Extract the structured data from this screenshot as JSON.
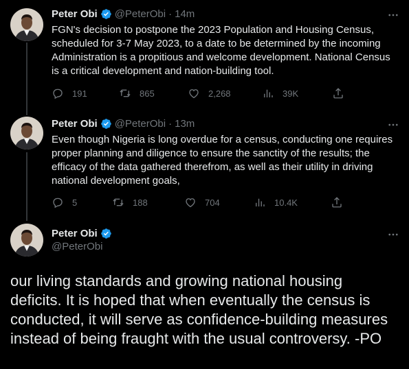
{
  "tweets": [
    {
      "name": "Peter Obi",
      "handle": "@PeterObi",
      "separator": "·",
      "time": "14m",
      "text": "FGN's decision to postpone the 2023 Population and Housing Census, scheduled for 3-7 May 2023, to a date to be determined by the incoming Administration is a propitious and welcome development. National Census is a critical development and nation-building tool.",
      "replies": "191",
      "retweets": "865",
      "likes": "2,268",
      "views": "39K"
    },
    {
      "name": "Peter Obi",
      "handle": "@PeterObi",
      "separator": "·",
      "time": "13m",
      "text": "Even though Nigeria is long overdue for a census, conducting one requires proper planning and diligence to ensure the sanctity of the results; the efficacy of the data gathered therefrom, as well as their utility in driving national development goals,",
      "replies": "5",
      "retweets": "188",
      "likes": "704",
      "views": "10.4K"
    },
    {
      "name": "Peter Obi",
      "handle": "@PeterObi",
      "text": "our living standards and growing national housing deficits. It is hoped that when eventually the census is conducted, it will serve as confidence-building measures instead of being fraught with the usual controversy. -PO"
    }
  ],
  "icons": {
    "more": "more-icon",
    "verified": "verified-badge-icon",
    "reply": "reply-icon",
    "retweet": "retweet-icon",
    "like": "like-icon",
    "views": "views-icon",
    "share": "share-icon"
  },
  "colors": {
    "background": "#000000",
    "text": "#e7e9ea",
    "muted": "#71767b",
    "verified": "#1d9bf0"
  }
}
